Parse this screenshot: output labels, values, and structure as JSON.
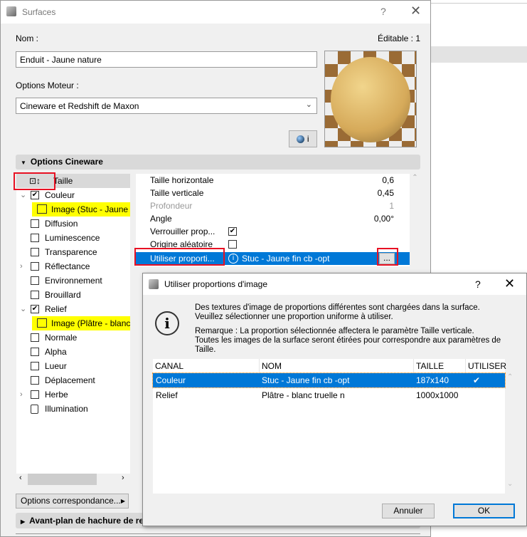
{
  "main": {
    "title": "Surfaces",
    "help": "?",
    "close": "✕",
    "name_label": "Nom :",
    "editable_label": "Éditable : 1",
    "name_value": "Enduit - Jaune nature",
    "engine_label": "Options Moteur :",
    "engine_value": "Cineware et Redshift de Maxon",
    "info_button": "i",
    "section_cineware": "Options Cineware",
    "section_hatch": "Avant-plan de hachure de reco",
    "mapping_button": "Options correspondance..."
  },
  "tree": [
    {
      "label": "Taille",
      "type": "size",
      "selected": true
    },
    {
      "label": "Couleur",
      "checked": true,
      "expand": "open"
    },
    {
      "label": "Image (Stuc - Jaune fi",
      "type": "image"
    },
    {
      "label": "Diffusion",
      "checked": false
    },
    {
      "label": "Luminescence",
      "checked": false
    },
    {
      "label": "Transparence",
      "checked": false
    },
    {
      "label": "Réflectance",
      "checked": false,
      "expand": "closed"
    },
    {
      "label": "Environnement",
      "checked": false
    },
    {
      "label": "Brouillard",
      "checked": false
    },
    {
      "label": "Relief",
      "checked": true,
      "expand": "open"
    },
    {
      "label": "Image (Plâtre - blanc t",
      "type": "image"
    },
    {
      "label": "Normale",
      "checked": false
    },
    {
      "label": "Alpha",
      "checked": false
    },
    {
      "label": "Lueur",
      "checked": false
    },
    {
      "label": "Déplacement",
      "checked": false
    },
    {
      "label": "Herbe",
      "checked": false,
      "expand": "closed"
    },
    {
      "label": "Illumination",
      "type": "light"
    }
  ],
  "props": [
    {
      "label": "Taille horizontale",
      "value": "0,6"
    },
    {
      "label": "Taille verticale",
      "value": "0,45"
    },
    {
      "label": "Profondeur",
      "value": "1",
      "disabled": true
    },
    {
      "label": "Angle",
      "value": "0,00°"
    },
    {
      "label": "Verrouiller prop...",
      "check": true
    },
    {
      "label": "Origine aléatoire",
      "check": false
    },
    {
      "label": "Utiliser proporti...",
      "info": "Stuc - Jaune fin cb -opt",
      "button": "...",
      "selected": true
    }
  ],
  "dialog": {
    "title": "Utiliser proportions d'image",
    "help": "?",
    "close": "✕",
    "msg1": "Des textures d'image de proportions différentes sont chargées dans la surface.",
    "msg2": "Veuillez sélectionner une proportion uniforme à utiliser.",
    "msg3": "Remarque : La proportion sélectionnée affectera le paramètre Taille verticale.",
    "msg4": "Toutes les images de la surface seront étirées pour correspondre aux paramètres de",
    "msg5": "Taille.",
    "columns": [
      "CANAL",
      "NOM",
      "TAILLE",
      "UTILISER"
    ],
    "rows": [
      {
        "canal": "Couleur",
        "nom": "Stuc - Jaune fin cb -opt",
        "taille": "187x140",
        "utiliser": "✔"
      },
      {
        "canal": "Relief",
        "nom": "Plâtre - blanc truelle n",
        "taille": "1000x1000",
        "utiliser": ""
      }
    ],
    "cancel": "Annuler",
    "ok": "OK"
  },
  "colors": {
    "selection": "#0078d7",
    "highlight": "#ffff00",
    "annotation": "#e81123"
  }
}
